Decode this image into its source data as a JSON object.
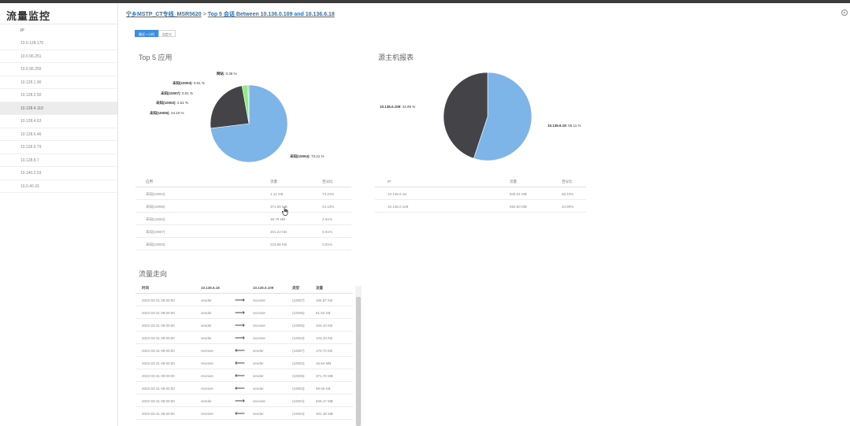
{
  "app": {
    "title": "流量监控"
  },
  "sidebar": {
    "header": "IP",
    "items": [
      "10.0.128.170",
      "10.0.96.251",
      "10.0.96.250",
      "10.128.1.90",
      "10.128.2.50",
      "10.128.4.110",
      "10.128.4.63",
      "10.128.6.46",
      "10.128.6.79",
      "10.128.8.7",
      "10.140.2.53",
      "10.0.40.33"
    ],
    "active_index": 5
  },
  "breadcrumb": {
    "link": "宁乡MSTP_CT专线_MSR5620",
    "sep": ">",
    "current": "Top 5 会话 Between 10.136.0.109 and 10.136.6.18"
  },
  "tabs": [
    {
      "label": "最近一小时",
      "active": true
    },
    {
      "label": "自定义",
      "active": false
    }
  ],
  "apps_section": {
    "title": "Top 5 应用",
    "pie_labels": [
      {
        "name": "网站",
        "pct": "0.36 %"
      },
      {
        "name": "未知(10003)",
        "pct": "0.01 %"
      },
      {
        "name": "未知(10007)",
        "pct": "0.01 %"
      },
      {
        "name": "未知(10002)",
        "pct": "2.51 %"
      },
      {
        "name": "未知(10006)",
        "pct": "24.10 %"
      },
      {
        "name": "未知(10004)",
        "pct": "73.21 %"
      }
    ],
    "table": {
      "columns": [
        "应用",
        "流量",
        "百分比"
      ],
      "rows": [
        [
          "未知(10004)",
          "1.12 GB",
          "73.21%"
        ],
        [
          "未知(10006)",
          "371.80 MB",
          "24.10%"
        ],
        [
          "未知(10002)",
          "38.78 MB",
          "2.51%"
        ],
        [
          "未知(10007)",
          "201.22 KB",
          "0.01%"
        ],
        [
          "未知(10003)",
          "223.98 KB",
          "0.01%"
        ]
      ]
    }
  },
  "hosts_section": {
    "title": "源主机报表",
    "pie_labels": [
      {
        "name": "10.136.0.109",
        "pct": "44.89 %"
      },
      {
        "name": "10.136.6.18",
        "pct": "55.11 %"
      }
    ],
    "table": {
      "columns": [
        "IP",
        "流量",
        "百分比"
      ],
      "rows": [
        [
          "10.136.6.18",
          "845.01 MB",
          "55.10%"
        ],
        [
          "10.136.0.109",
          "692.50 MB",
          "44.90%"
        ]
      ]
    }
  },
  "flow_section": {
    "title": "流量走向",
    "columns": [
      "时间",
      "10.136.6.18",
      "",
      "10.136.0.109",
      "类型",
      "流量"
    ],
    "rows": [
      {
        "time": "2022-03-31 09:00:00",
        "a": "sender",
        "dir": "right",
        "b": "receiver",
        "type": "(10007)",
        "size": "166.87 KB"
      },
      {
        "time": "2022-03-31 09:00:00",
        "a": "sender",
        "dir": "right",
        "b": "receiver",
        "type": "(10006)",
        "size": "81.82 KB"
      },
      {
        "time": "2022-03-31 09:00:00",
        "a": "sender",
        "dir": "right",
        "b": "receiver",
        "type": "(10005)",
        "size": "104.43 KB"
      },
      {
        "time": "2022-03-31 09:00:00",
        "a": "sender",
        "dir": "right",
        "b": "receiver",
        "type": "(10003)",
        "size": "104.43 KB"
      },
      {
        "time": "2022-03-31 09:00:00",
        "a": "receiver",
        "dir": "left",
        "b": "sender",
        "type": "(10007)",
        "size": "170.70 KB"
      },
      {
        "time": "2022-03-31 09:00:00",
        "a": "receiver",
        "dir": "left",
        "b": "sender",
        "type": "(10002)",
        "size": "16.84 MB"
      },
      {
        "time": "2022-03-31 09:00:00",
        "a": "receiver",
        "dir": "left",
        "b": "sender",
        "type": "(10006)",
        "size": "371.76 MB"
      },
      {
        "time": "2022-03-31 09:00:00",
        "a": "receiver",
        "dir": "left",
        "b": "sender",
        "type": "(10003)",
        "size": "89.55 KB"
      },
      {
        "time": "2022-03-31 09:00:00",
        "a": "sender",
        "dir": "right",
        "b": "receiver",
        "type": "(10004)",
        "size": "829.47 MB"
      },
      {
        "time": "2022-03-31 09:00:00",
        "a": "receiver",
        "dir": "left",
        "b": "sender",
        "type": "(10004)",
        "size": "301.38 MB"
      }
    ]
  },
  "chart_data": [
    {
      "type": "pie",
      "title": "Top 5 应用",
      "categories": [
        "未知(10004)",
        "未知(10006)",
        "未知(10002)",
        "未知(10007)",
        "未知(10003)",
        "网站"
      ],
      "values": [
        73.21,
        24.1,
        2.51,
        0.01,
        0.01,
        0.36
      ],
      "colors": [
        "#7db5e8",
        "#434348",
        "#90ed7d",
        "#f7a35c",
        "#8085e9",
        "#f15c80"
      ]
    },
    {
      "type": "pie",
      "title": "源主机报表",
      "categories": [
        "10.136.6.18",
        "10.136.0.109"
      ],
      "values": [
        55.11,
        44.89
      ],
      "colors": [
        "#7db5e8",
        "#434348"
      ]
    }
  ]
}
